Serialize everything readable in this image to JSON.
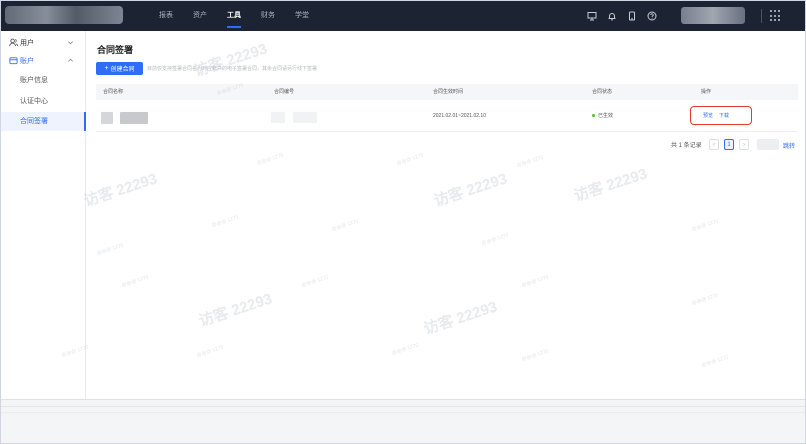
{
  "topbar": {
    "nav": [
      {
        "label": "报表",
        "active": false
      },
      {
        "label": "资产",
        "active": false
      },
      {
        "label": "工具",
        "active": true
      },
      {
        "label": "财务",
        "active": false
      },
      {
        "label": "学堂",
        "active": false
      }
    ],
    "icons": [
      "screen-icon",
      "bell-icon",
      "mobile-icon",
      "help-icon"
    ]
  },
  "sidebar": {
    "group_user": "用户",
    "group_account": "账户",
    "items": [
      "账户信息",
      "认证中心",
      "合同签署"
    ]
  },
  "main": {
    "title": "合同签署",
    "create_button": "创建合同",
    "create_icon": "+",
    "hint": "目前仅支持签署合同名为对应账户的电子签署合同，其余合同请另行线下签署"
  },
  "table": {
    "headers": [
      "合同名称",
      "合同编号",
      "合同生效时间",
      "合同状态",
      "操作"
    ],
    "rows": [
      {
        "name": "",
        "number": "",
        "period": "2021.02.01~2021.02.10",
        "status": "已生效",
        "status_color": "#52c41a",
        "actions": [
          "预览",
          "下载"
        ]
      }
    ]
  },
  "pagination": {
    "total_text": "共 1 条记录",
    "prev": "‹",
    "current": "1",
    "next": "›",
    "jump": "跳转"
  },
  "watermark": {
    "big": "访客 22293",
    "small": "@@@ 1270"
  },
  "colors": {
    "accent": "#2f6df6",
    "topbar": "#1c2333",
    "highlight_box": "#e23d2b",
    "status_ok": "#52c41a"
  }
}
